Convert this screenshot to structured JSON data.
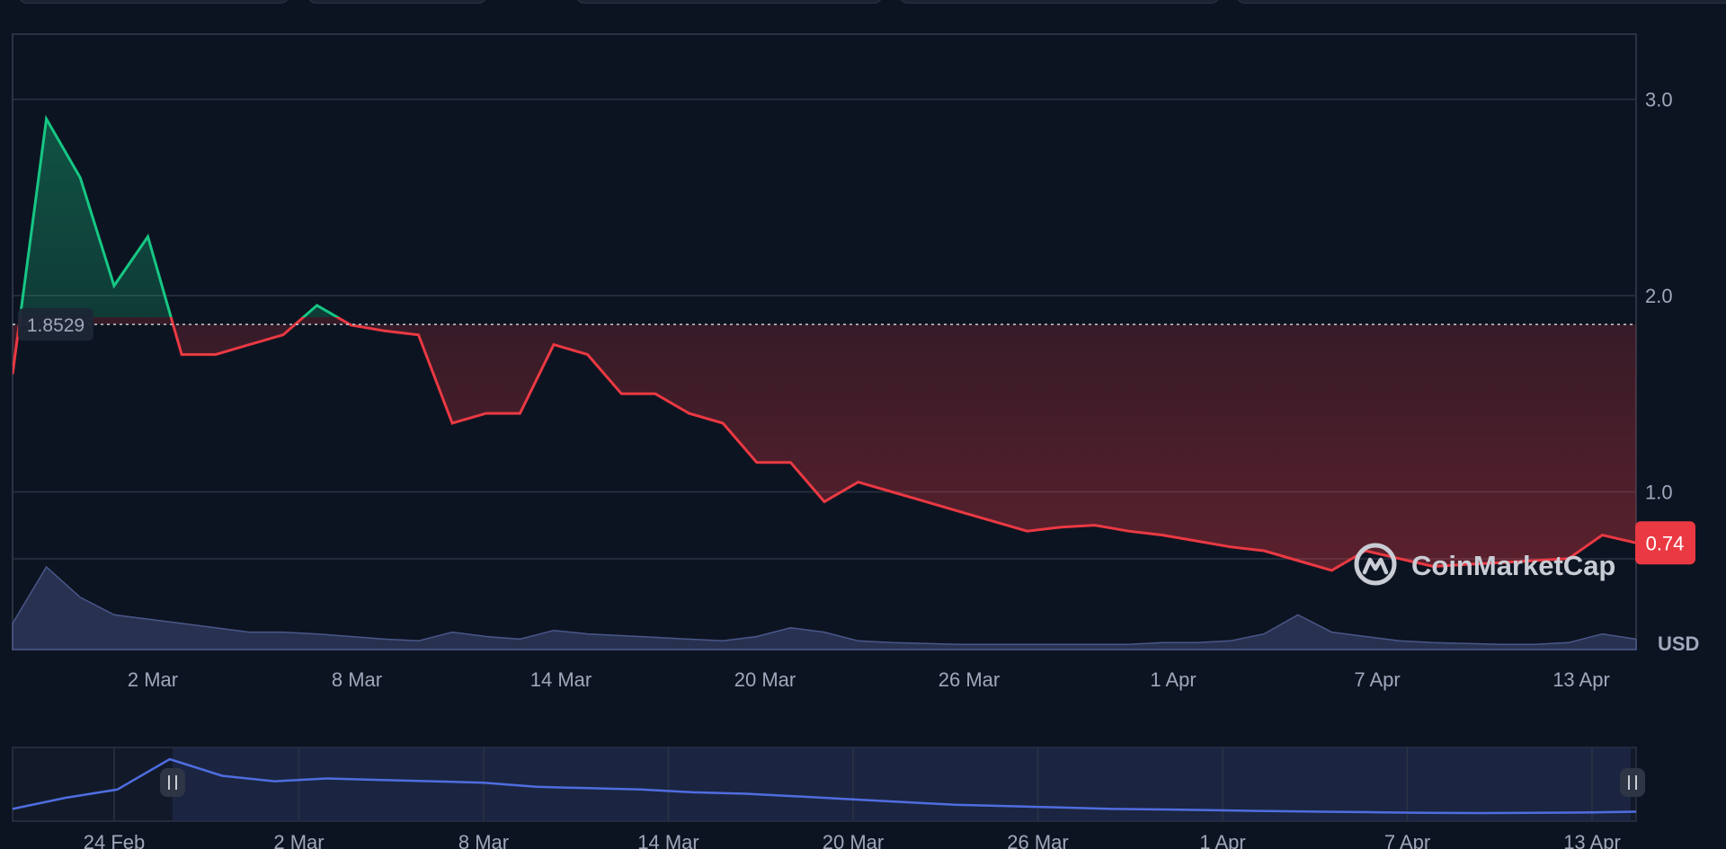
{
  "chart_data": {
    "type": "area",
    "currency": "USD",
    "baseline_value": "1.8529",
    "current_price_label": "0.74",
    "y_ticks": [
      "3.0",
      "2.0",
      "1.0"
    ],
    "ylim": [
      0,
      4.0
    ],
    "x_ticks": [
      "2 Mar",
      "8 Mar",
      "14 Mar",
      "20 Mar",
      "26 Mar",
      "1 Apr",
      "7 Apr",
      "13 Apr"
    ],
    "navigator_ticks": [
      "24 Feb",
      "2 Mar",
      "8 Mar",
      "14 Mar",
      "20 Mar",
      "26 Mar",
      "1 Apr",
      "7 Apr",
      "13 Apr"
    ],
    "grid": true,
    "colors": {
      "up": "#16c784",
      "down": "#ea3943",
      "volume": "#3a4670",
      "navigator": "#4f6de0",
      "background": "#0d1421"
    },
    "series": [
      {
        "x": [
          "25 Feb",
          "26 Feb",
          "27 Feb",
          "28 Feb",
          "1 Mar",
          "2 Mar",
          "3 Mar",
          "4 Mar",
          "5 Mar",
          "6 Mar",
          "7 Mar",
          "8 Mar",
          "9 Mar",
          "10 Mar",
          "11 Mar",
          "12 Mar",
          "13 Mar",
          "14 Mar",
          "15 Mar",
          "16 Mar",
          "17 Mar",
          "18 Mar",
          "19 Mar",
          "20 Mar",
          "21 Mar",
          "22 Mar",
          "23 Mar",
          "24 Mar",
          "25 Mar",
          "26 Mar",
          "27 Mar",
          "28 Mar",
          "29 Mar",
          "30 Mar",
          "31 Mar",
          "1 Apr",
          "2 Apr",
          "3 Apr",
          "4 Apr",
          "5 Apr",
          "6 Apr",
          "7 Apr",
          "8 Apr",
          "9 Apr",
          "10 Apr",
          "11 Apr",
          "12 Apr",
          "13 Apr",
          "14 Apr"
        ],
        "values": [
          1.6,
          2.9,
          2.6,
          2.05,
          2.3,
          1.7,
          1.7,
          1.75,
          1.8,
          1.95,
          1.85,
          1.82,
          1.8,
          1.35,
          1.4,
          1.4,
          1.75,
          1.7,
          1.5,
          1.5,
          1.4,
          1.35,
          1.15,
          1.15,
          0.95,
          1.05,
          1.0,
          0.95,
          0.9,
          0.85,
          0.8,
          0.82,
          0.83,
          0.8,
          0.78,
          0.75,
          0.72,
          0.7,
          0.65,
          0.6,
          0.7,
          0.66,
          0.62,
          0.63,
          0.64,
          0.65,
          0.66,
          0.78,
          0.74
        ]
      }
    ],
    "volume": [
      30,
      95,
      60,
      40,
      35,
      30,
      25,
      20,
      20,
      18,
      15,
      12,
      10,
      20,
      15,
      12,
      22,
      18,
      16,
      14,
      12,
      10,
      15,
      25,
      20,
      10,
      8,
      7,
      6,
      6,
      6,
      6,
      6,
      6,
      8,
      8,
      10,
      18,
      40,
      20,
      15,
      10,
      8,
      7,
      6,
      6,
      8,
      18,
      12
    ],
    "navigator": [
      0.8,
      1.2,
      1.5,
      2.6,
      2.0,
      1.8,
      1.9,
      1.85,
      1.8,
      1.75,
      1.6,
      1.55,
      1.5,
      1.4,
      1.35,
      1.25,
      1.15,
      1.05,
      0.95,
      0.9,
      0.85,
      0.8,
      0.78,
      0.75,
      0.72,
      0.7,
      0.68,
      0.66,
      0.65,
      0.66,
      0.67,
      0.7
    ]
  }
}
